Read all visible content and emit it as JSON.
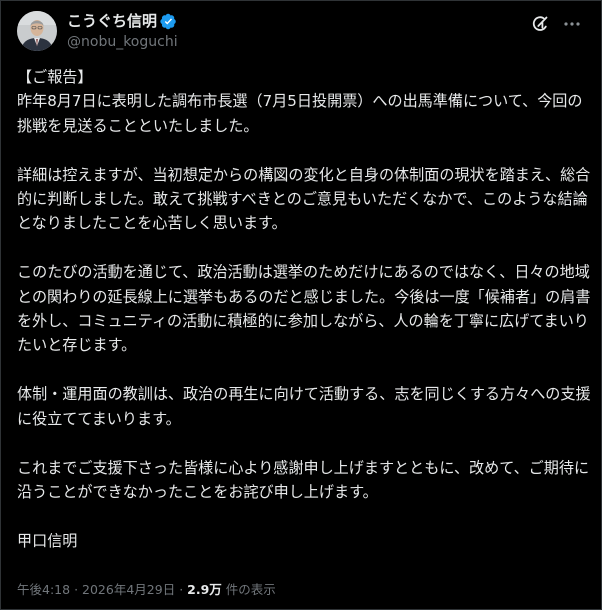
{
  "author": {
    "display_name": "こうぐち信明",
    "handle": "@nobu_koguchi",
    "verified": true
  },
  "header_icons": [
    "grok-icon",
    "more-icon"
  ],
  "post": {
    "body": "【ご報告】\n昨年8月7日に表明した調布市長選（7月5日投開票）への出馬準備について、今回の挑戦を見送ることといたしました。\n\n詳細は控えますが、当初想定からの構図の変化と自身の体制面の現状を踏まえ、総合的に判断しました。敢えて挑戦すべきとのご意見もいただくなかで、このような結論となりましたことを心苦しく思います。\n\nこのたびの活動を通じて、政治活動は選挙のためだけにあるのではなく、日々の地域との関わりの延長線上に選挙もあるのだと感じました。今後は一度「候補者」の肩書を外し、コミュニティの活動に積極的に参加しながら、人の輪を丁寧に広げてまいりたいと存じます。\n\n体制・運用面の教訓は、政治の再生に向けて活動する、志を同じくする方々への支援に役立ててまいります。\n\nこれまでご支援下さった皆様に心より感謝申し上げますとともに、改めて、ご期待に沿うことができなかったことをお詫び申し上げます。\n\n甲口信明"
  },
  "meta": {
    "time": "午後4:18",
    "separator": "·",
    "date": "2026年4月29日",
    "views_count": "2.9万",
    "views_label": "件の表示"
  },
  "colors": {
    "background": "#000000",
    "text_primary": "#e7e9ea",
    "text_secondary": "#71767b",
    "verified_badge": "#1d9bf0",
    "border": "#2f3336"
  }
}
